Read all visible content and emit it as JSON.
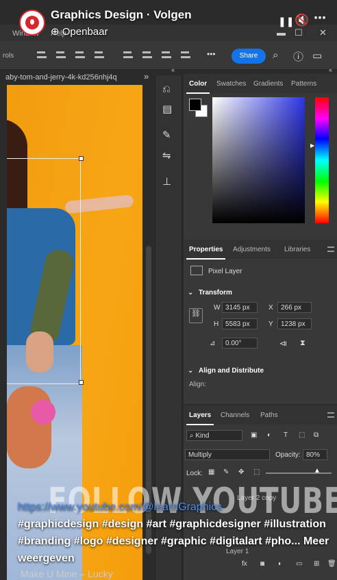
{
  "video_header": {
    "channel_title": "Graphics Design · Volgen",
    "visibility": "Openbaar",
    "pause_icon": "pause-icon",
    "mute_icon": "mute-icon",
    "more_icon": "more-icon"
  },
  "menubar": {
    "window": "Window",
    "help": "Help"
  },
  "optbar": {
    "label": "rols",
    "share": "Share",
    "more": "•••"
  },
  "document": {
    "tab_name": "aby-tom-and-jerry-4k-kd256nhj4q"
  },
  "color_panel": {
    "tabs": [
      "Color",
      "Swatches",
      "Gradients",
      "Patterns"
    ],
    "active_tab": "Color"
  },
  "properties_panel": {
    "tabs": [
      "Properties",
      "Adjustments",
      "Libraries"
    ],
    "layer_type": "Pixel Layer",
    "transform_label": "Transform",
    "w_label": "W",
    "w_value": "3145 px",
    "h_label": "H",
    "h_value": "5583 px",
    "x_label": "X",
    "x_value": "266 px",
    "y_label": "Y",
    "y_value": "1238 px",
    "angle": "0.00°",
    "align_label": "Align and Distribute",
    "align_sub": "Align:"
  },
  "layers_panel": {
    "tabs": [
      "Layers",
      "Channels",
      "Paths"
    ],
    "kind": "Kind",
    "blend_mode": "Multiply",
    "opacity_label": "Opacity:",
    "opacity_value": "80%",
    "lock_label": "Lock:",
    "layer_copy": "Layer 2 copy",
    "layer1": "Layer 1"
  },
  "watermark": "FOLLOW YOUTUBE",
  "caption": {
    "link": "https://www.youtube.com/@learnGraphics",
    "text": "#graphicdesign #design #art #graphicdesigner #illustration #branding #logo #designer #graphic #digitalart #pho...",
    "more": "Meer weergeven"
  },
  "song": "Make U Mine – Lucky"
}
